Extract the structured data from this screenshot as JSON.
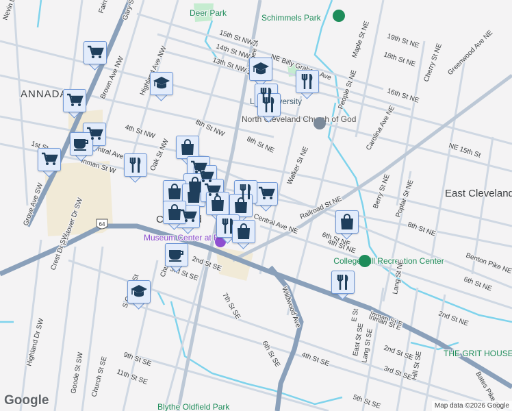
{
  "map": {
    "neighborhoods": [
      "ANNADALE",
      "East Cleveland"
    ],
    "parks": [
      "Deer Park",
      "Schimmels Park",
      "College Hill Recreation Center",
      "Blythe Oldfield Park"
    ],
    "places": [
      "Lee University",
      "North Cleveland Church of God",
      "Museum Center at Five Points",
      "THE GRIT HOUSE",
      "Cleveland"
    ],
    "route_shield": "64",
    "streets": [
      "15th St NW",
      "14th St NW",
      "13th St NW",
      "NE Billy Graham Ave",
      "8th St NW",
      "4th St NW",
      "Central Ave NW",
      "1st St",
      "Inman St W",
      "Oak St NW",
      "Brown Ave NW",
      "Highland Ave NW",
      "Gary St",
      "Fairmont",
      "Nevin Ln",
      "Grove Ave SW",
      "Westover Dr SW",
      "Crest Dr SW",
      "Highland Dr SW",
      "N Ocoee St",
      "8th St NE",
      "Central Ave NE",
      "Walker St NE",
      "Railroad St NE",
      "People St NE",
      "Maple St NE",
      "19th St NE",
      "18th St NE",
      "16th St NE",
      "Cherry St NE",
      "Greenwood Ave NE",
      "Carolina Ave NE",
      "NE 15th St",
      "Berry St NE",
      "Poplar St NE",
      "8th St NE",
      "6th St NE",
      "4th St NE",
      "Benton Pike NE",
      "6th St NE",
      "2nd St NE",
      "Inman St E",
      "Wildwood Ave",
      "7th St SE",
      "6th St SE",
      "4th St SE",
      "2nd St SE",
      "3rd St SE",
      "5th St SE",
      "East St SE",
      "Lang St SE",
      "Hill St SE",
      "Bates Pike SE",
      "E St",
      "Lang St NE",
      "2nd St SE",
      "3rd St SE",
      "Church St",
      "S Ocoee St",
      "9th St SE",
      "11th St SE",
      "Church St SE",
      "Goode St SW",
      "Inman St E"
    ],
    "attribution": "Map data ©2026 Google",
    "logo": "Google"
  },
  "markers": [
    {
      "type": "cart"
    },
    {
      "type": "school"
    },
    {
      "type": "cart"
    },
    {
      "type": "cart"
    },
    {
      "type": "coffee"
    },
    {
      "type": "cart"
    },
    {
      "type": "restaurant"
    },
    {
      "type": "shopping"
    },
    {
      "type": "school"
    },
    {
      "type": "restaurant"
    },
    {
      "type": "restaurant"
    },
    {
      "type": "restaurant"
    },
    {
      "type": "cart"
    },
    {
      "type": "cart"
    },
    {
      "type": "shopping"
    },
    {
      "type": "shopping"
    },
    {
      "type": "shopping"
    },
    {
      "type": "cart"
    },
    {
      "type": "cart"
    },
    {
      "type": "restaurant"
    },
    {
      "type": "shopping"
    },
    {
      "type": "shopping"
    },
    {
      "type": "cart"
    },
    {
      "type": "shopping"
    },
    {
      "type": "restaurant"
    },
    {
      "type": "shopping"
    },
    {
      "type": "coffee"
    },
    {
      "type": "school"
    },
    {
      "type": "shopping"
    },
    {
      "type": "restaurant"
    }
  ],
  "colors": {
    "marker_icon": "#1f3f5c",
    "highway": "#8aa0ba",
    "road": "#c9d3df",
    "water": "#7fd3ec",
    "park": "#c5ecd0",
    "park_text": "#1e8c5a",
    "poi_purple": "#8e4fd0"
  }
}
